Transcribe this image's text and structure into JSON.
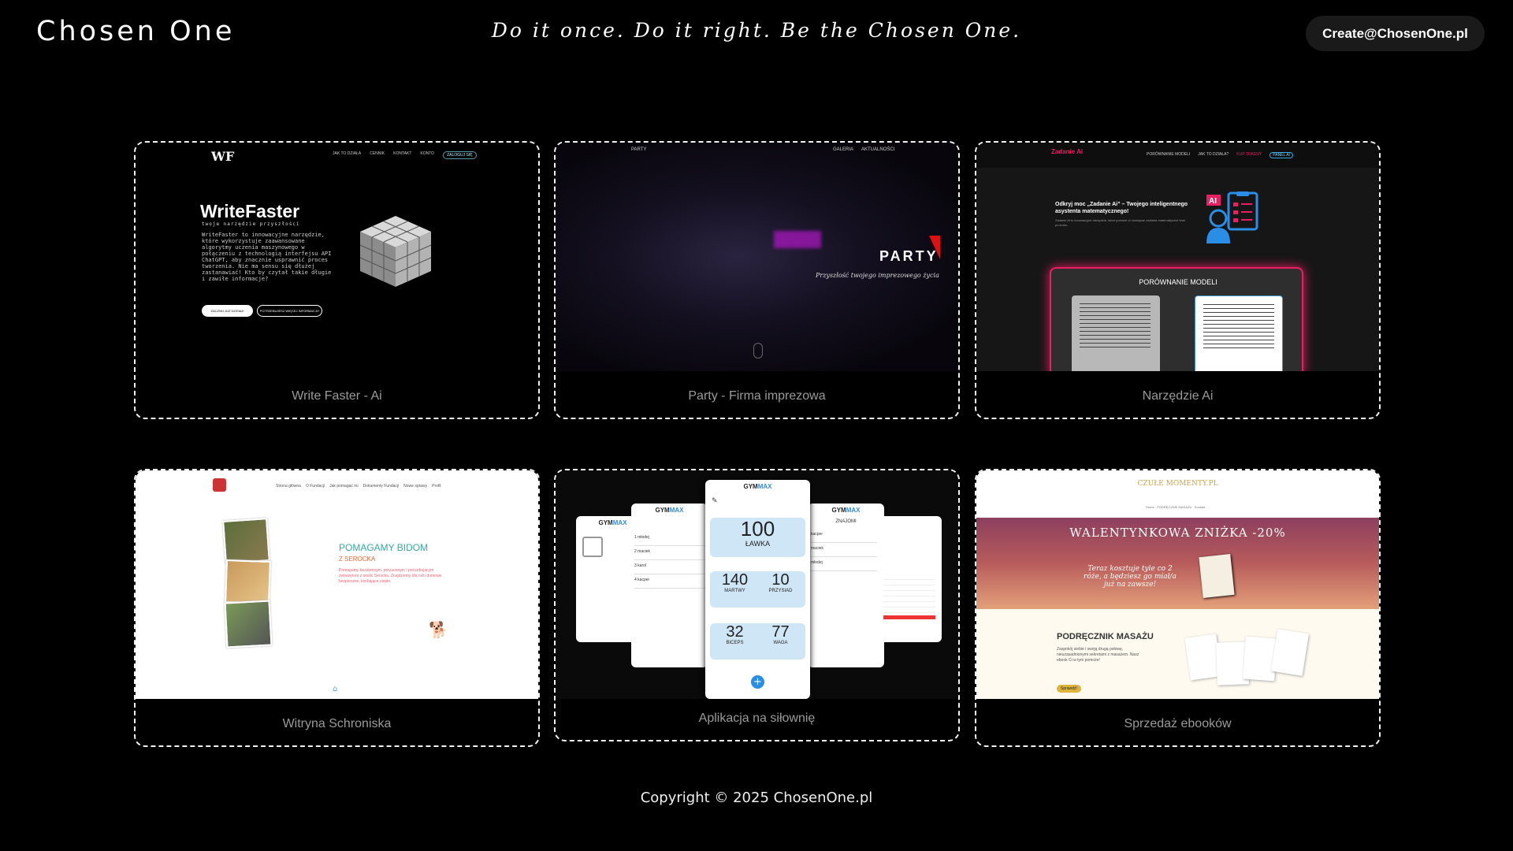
{
  "header": {
    "logo": "Chosen One",
    "tagline": "Do it once.  Do it right.  Be the Chosen One.",
    "email": "Create@ChosenOne.pl"
  },
  "projects": [
    {
      "caption": "Write Faster - Ai",
      "preview": {
        "logo": "WF",
        "nav": [
          "JAK TO DZIAŁA",
          "CENNIK",
          "KONTAKT",
          "KONTO",
          "ZALOGUJ SIĘ"
        ],
        "title": "WriteFaster",
        "subtitle": "twoje narzędzie przyszłości",
        "body": "WriteFaster to innowacyjne narzędzie, które wykorzystuje zaawansowane algorytmy uczenia maszynowego w połączeniu z technologią interfejsu API ChatGPT, aby znacznie usprawnić proces tworzenia. Nie ma sensu się dłużej zastanawiać! Kto by czytał takie długie i zawiłe informacje?",
        "btn_primary": "ZACZNIJ JUŻ DZISIAJ!",
        "btn_secondary": "POTRZEBUJESZ WIĘCEJ INFORMACJI?"
      }
    },
    {
      "caption": "Party - Firma imprezowa",
      "preview": {
        "brand": "PARTY",
        "nav": [
          "GALERIA",
          "AKTUALNOŚCI"
        ],
        "title": "PARTY",
        "subtitle": "Przyszłość twojego imprezowego życia"
      }
    },
    {
      "caption": "Narzędzie Ai",
      "preview": {
        "logo": "Zadanie Ai",
        "nav": [
          "PORÓWNANIE MODELI",
          "JAK TO DZIAŁA?",
          "KUP TOKENY",
          "PANEL AI"
        ],
        "headline": "Odkryj moc „Zadanie Ai” – Twojego inteligentnego asystenta matematycznego!",
        "body": "Zadanie Ai to innowacyjne narzędzie, które pomoże ci rozwiązać zadania matematyczne krok po kroku.",
        "panel_title": "PORÓWNANIE MODELI"
      }
    },
    {
      "caption": "Witryna Schroniska",
      "preview": {
        "nav": [
          "Strona główna",
          "O Fundacji",
          "Jak pomagać mi",
          "Dokumenty Fundacji",
          "Nowe sprawy",
          "Profil"
        ],
        "heading": "POMAGAMY BIDOM",
        "subheading": "Z SEROCKA",
        "body": "Pomagamy bezdomnym, porzuconym i potrzebującym zwierzętom z okolic Serocka. Znajdziemy dla nich domowe, bezpieczne, kochające ciepło."
      }
    },
    {
      "caption": "Aplikacja na siłownię",
      "preview": {
        "brand_a": "GYM",
        "brand_b": "MAX",
        "stats": [
          {
            "value": "100",
            "label": "ŁAWKA"
          },
          {
            "value": "140",
            "label": "MARTWY"
          },
          {
            "value": "10",
            "label": "PRZYSIAD"
          },
          {
            "value": "32",
            "label": "BICEPS"
          },
          {
            "value": "77",
            "label": "WAGA"
          }
        ],
        "list": [
          "1 młodej",
          "2 maciek",
          "3 karol",
          "4 kacper"
        ],
        "friends_title": "ZNAJOMI",
        "friends": [
          "kacper",
          "maciek",
          "młodej"
        ]
      }
    },
    {
      "caption": "Sprzedaż ebooków",
      "preview": {
        "logo": "CZUŁE MOMENTY.PL",
        "nav": "Home · PODRĘCZNIK MASAŻU · Kontakt",
        "banner_title": "WALENTYNKOWA ZNIŻKA -20%",
        "banner_sub": "Teraz kosztuje tyle co 2 róże, a będziesz go miał/a już na zawsze!",
        "section_title": "PODRĘCZNIK MASAŻU",
        "section_body": "Zaspokój siebie i swoją drugą połowę, nieuzasadnionymi sekretami z masażem. Nasz ebook Ci w tym pomoże!",
        "cta": "Sprawdź!"
      }
    }
  ],
  "footer": {
    "copyright": "Copyright © 2025 ChosenOne.pl"
  }
}
